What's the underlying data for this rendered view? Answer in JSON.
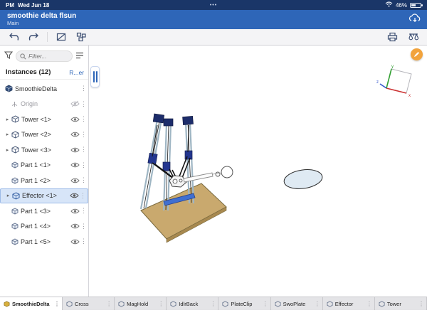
{
  "status_bar": {
    "time": "PM",
    "date": "Wed Jun 18",
    "app_switcher_dots": "•••",
    "battery_percent": "46%"
  },
  "title_bar": {
    "title": "smoothie delta flsun",
    "subtitle": "Main"
  },
  "left_panel": {
    "filter": {
      "placeholder": "Filter..."
    },
    "header": {
      "instances": "Instances (12)",
      "action": "R...er"
    },
    "tree": [
      {
        "label": "SmoothieDelta"
      },
      {
        "label": "Origin"
      },
      {
        "label": "Tower <1>"
      },
      {
        "label": "Tower <2>"
      },
      {
        "label": "Tower <3>"
      },
      {
        "label": "Part 1 <1>"
      },
      {
        "label": "Part 1 <2>"
      },
      {
        "label": "Effector <1>"
      },
      {
        "label": "Part 1 <3>"
      },
      {
        "label": "Part 1 <4>"
      },
      {
        "label": "Part 1 <5>"
      }
    ]
  },
  "canvas": {
    "triad": {
      "x": "x",
      "y": "y",
      "z": "z"
    }
  },
  "tabs": [
    {
      "label": "SmoothieDelta"
    },
    {
      "label": "Cross"
    },
    {
      "label": "MagHold"
    },
    {
      "label": "IdlrBack"
    },
    {
      "label": "PlateClip"
    },
    {
      "label": "SwoPlate"
    },
    {
      "label": "Effector"
    },
    {
      "label": "Tower"
    }
  ],
  "colors": {
    "accent_blue": "#2e66b8",
    "selection": "#d7e5f8",
    "orange": "#f2a33c"
  }
}
